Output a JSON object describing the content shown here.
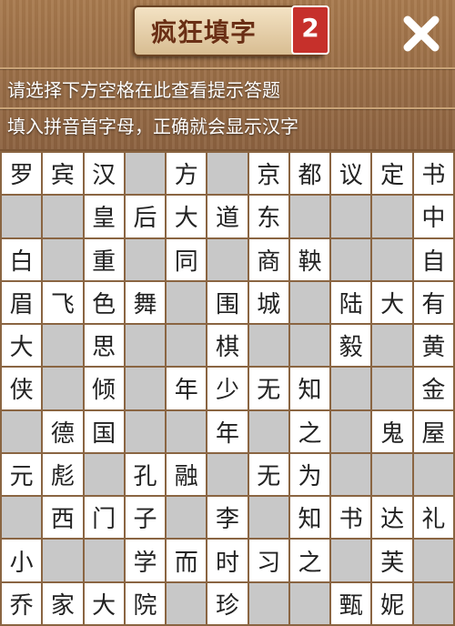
{
  "header": {
    "title": "疯狂填字",
    "level": "2",
    "close_icon": "close-x-icon"
  },
  "hints": {
    "line1": "请选择下方空格在此查看提示答题",
    "line2": "填入拼音首字母，正确就会显示汉字"
  },
  "grid": [
    [
      "罗",
      "宾",
      "汉",
      "",
      "方",
      "",
      "京",
      "都",
      "议",
      "定",
      "书"
    ],
    [
      "",
      "",
      "皇",
      "后",
      "大",
      "道",
      "东",
      "",
      "",
      "",
      "中"
    ],
    [
      "白",
      "",
      "重",
      "",
      "同",
      "",
      "商",
      "鞅",
      "",
      "",
      "自"
    ],
    [
      "眉",
      "飞",
      "色",
      "舞",
      "",
      "围",
      "城",
      "",
      "陆",
      "大",
      "有"
    ],
    [
      "大",
      "",
      "思",
      "",
      "",
      "棋",
      "",
      "",
      "毅",
      "",
      "黄"
    ],
    [
      "侠",
      "",
      "倾",
      "",
      "年",
      "少",
      "无",
      "知",
      "",
      "",
      "金"
    ],
    [
      "",
      "德",
      "国",
      "",
      "",
      "年",
      "",
      "之",
      "",
      "鬼",
      "屋"
    ],
    [
      "元",
      "彪",
      "",
      "孔",
      "融",
      "",
      "无",
      "为",
      "",
      "",
      ""
    ],
    [
      "",
      "西",
      "门",
      "子",
      "",
      "李",
      "",
      "知",
      "书",
      "达",
      "礼"
    ],
    [
      "小",
      "",
      "",
      "学",
      "而",
      "时",
      "习",
      "之",
      "",
      "芙",
      ""
    ],
    [
      "乔",
      "家",
      "大",
      "院",
      "",
      "珍",
      "",
      "",
      "甄",
      "妮",
      ""
    ]
  ]
}
